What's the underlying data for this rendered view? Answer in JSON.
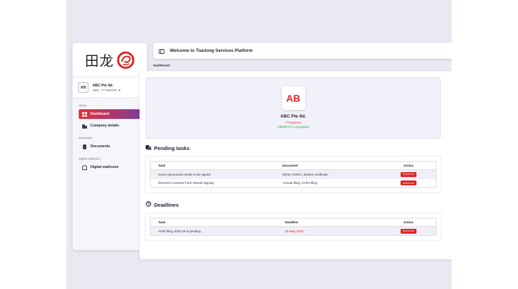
{
  "sidebar": {
    "logo_text": "田龙",
    "company": {
      "name": "ABC Pte ltd.",
      "uen": "UEN : ****34374H",
      "initials": "AB"
    },
    "sections": [
      "Home",
      "Document",
      "Digital mailroom"
    ],
    "items": [
      {
        "label": "Dashboard",
        "icon": "grid-icon",
        "active": true
      },
      {
        "label": "Company details",
        "icon": "building-icon"
      },
      {
        "label": "Documents",
        "icon": "document-icon"
      },
      {
        "label": "Digital mailroom",
        "icon": "mailbox-icon"
      }
    ]
  },
  "header": {
    "title": "Welcome to Tianlong Services Platform",
    "notification_count": "0"
  },
  "breadcrumb": "Dashboard",
  "profile": {
    "initials": "AB",
    "name": "ABC Pte ltd.",
    "uen": "****34374H",
    "status": "CDD/KYC in progress"
  },
  "pending": {
    "title": "Pending tasks",
    "columns": [
      "Task",
      "Document",
      "Action"
    ],
    "rows": [
      {
        "task": "Some documents needs to be signed",
        "document": "DRIM, RORC, Shares certificate",
        "action": "Check now"
      },
      {
        "task": "Director's Consent Form Needs Signing",
        "document": "Annual filing, ACRA filing",
        "action": "Check now"
      }
    ]
  },
  "deadlines": {
    "title": "Deadlines",
    "columns": [
      "Task",
      "Deadline",
      "Action"
    ],
    "rows": [
      {
        "task": "AGM filing 2025-26 is pending",
        "deadline": "15 May 2025",
        "action": "Check now"
      }
    ]
  },
  "colors": {
    "accent": "#e02424",
    "gradient_end": "#7a3d9c",
    "success": "#22a845"
  }
}
